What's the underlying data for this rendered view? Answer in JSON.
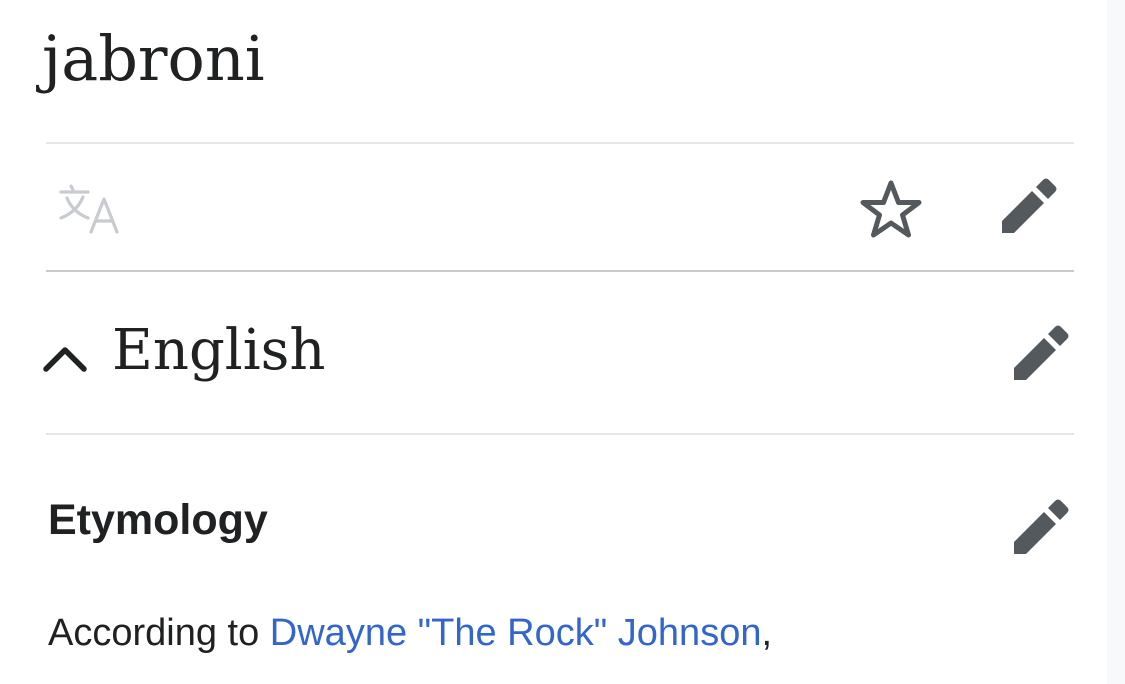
{
  "page": {
    "title": "jabroni"
  },
  "toolbar": {
    "icons": [
      "translate-icon",
      "star-icon",
      "pencil-icon"
    ]
  },
  "language_section": {
    "name": "English",
    "expanded": true
  },
  "etymology": {
    "heading": "Etymology",
    "text_prefix": "According to ",
    "link_text": "Dwayne \"The Rock\" Johnson",
    "text_suffix": ","
  },
  "colors": {
    "text": "#202122",
    "link": "#3366cc",
    "icon": "#54595d",
    "icon_disabled": "#c8ccd1",
    "divider": "#e6e6e8"
  }
}
